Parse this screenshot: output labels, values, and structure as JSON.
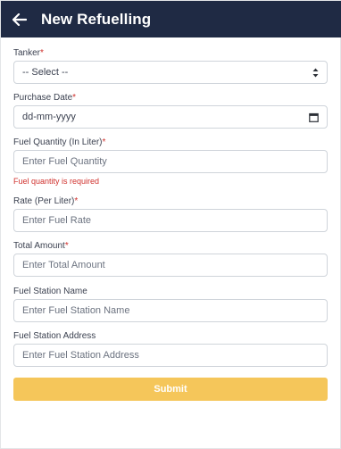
{
  "header": {
    "title": "New Refuelling",
    "back_icon": "arrow-left-icon",
    "background": "#1f2a44"
  },
  "form": {
    "tanker": {
      "label": "Tanker",
      "required_mark": "*",
      "value": "-- Select --",
      "icon": "sort-icon"
    },
    "purchase_date": {
      "label": "Purchase Date",
      "required_mark": "*",
      "placeholder": "dd-mm-yyyy",
      "icon": "calendar-icon"
    },
    "fuel_quantity": {
      "label": "Fuel Quantity (In Liter)",
      "required_mark": "*",
      "placeholder": "Enter Fuel Quantity",
      "error": "Fuel quantity is required"
    },
    "rate": {
      "label": "Rate (Per Liter)",
      "required_mark": "*",
      "placeholder": "Enter Fuel Rate"
    },
    "total_amount": {
      "label": "Total Amount",
      "required_mark": "*",
      "placeholder": "Enter Total Amount"
    },
    "station_name": {
      "label": "Fuel Station Name",
      "placeholder": "Enter Fuel Station Name"
    },
    "station_address": {
      "label": "Fuel Station Address",
      "placeholder": "Enter Fuel Station Address"
    }
  },
  "submit": {
    "label": "Submit",
    "color": "#f5c65a"
  },
  "colors": {
    "error": "#d0312d",
    "border": "#cfd4da"
  }
}
